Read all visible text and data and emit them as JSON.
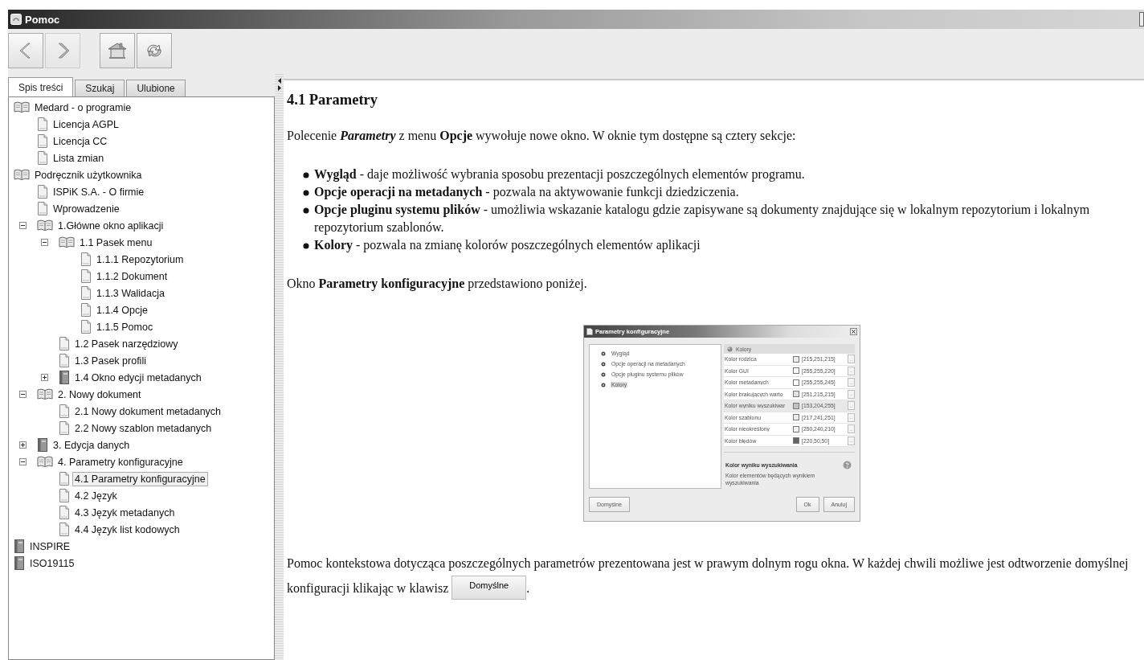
{
  "window": {
    "title": "Pomoc"
  },
  "toolbar": {
    "groups": [
      [
        {
          "kind": "back",
          "disabled": false
        },
        {
          "kind": "forward",
          "disabled": true
        }
      ],
      [
        {
          "kind": "home",
          "disabled": false
        },
        {
          "kind": "refresh",
          "disabled": false
        }
      ]
    ]
  },
  "tabs": [
    {
      "label": "Spis treści",
      "selected": true
    },
    {
      "label": "Szukaj",
      "selected": false
    },
    {
      "label": "Ulubione",
      "selected": false
    }
  ],
  "tree": {
    "items": [
      {
        "label": "Medard - o programie",
        "kind": "book",
        "expanded": true,
        "toggle": false,
        "selected": false,
        "children": [
          {
            "label": "Licencja AGPL",
            "kind": "page",
            "selected": false
          },
          {
            "label": "Licencja CC",
            "kind": "page",
            "selected": false
          },
          {
            "label": "Lista zmian",
            "kind": "page",
            "selected": false
          }
        ]
      },
      {
        "label": "Podręcznik użytkownika",
        "kind": "book",
        "expanded": true,
        "toggle": false,
        "selected": false,
        "children": [
          {
            "label": "ISPiK S.A. - O firmie",
            "kind": "page",
            "selected": false
          },
          {
            "label": "Wprowadzenie",
            "kind": "page",
            "selected": false
          },
          {
            "label": "1.Główne okno aplikacji",
            "kind": "book",
            "expanded": true,
            "toggle": true,
            "selected": false,
            "children": [
              {
                "label": "1.1 Pasek menu",
                "kind": "book",
                "expanded": true,
                "toggle": true,
                "selected": false,
                "children": [
                  {
                    "label": "1.1.1 Repozytorium",
                    "kind": "page",
                    "selected": false
                  },
                  {
                    "label": "1.1.2 Dokument",
                    "kind": "page",
                    "selected": false
                  },
                  {
                    "label": "1.1.3 Walidacja",
                    "kind": "page",
                    "selected": false
                  },
                  {
                    "label": "1.1.4 Opcje",
                    "kind": "page",
                    "selected": false
                  },
                  {
                    "label": "1.1.5 Pomoc",
                    "kind": "page",
                    "selected": false
                  }
                ]
              },
              {
                "label": "1.2 Pasek narzędziowy",
                "kind": "page",
                "selected": false
              },
              {
                "label": "1.3 Pasek profili",
                "kind": "page",
                "selected": false
              },
              {
                "label": "1.4 Okno edycji metadanych",
                "kind": "book",
                "expanded": false,
                "toggle": true,
                "selected": false
              }
            ]
          },
          {
            "label": "2. Nowy dokument",
            "kind": "book",
            "expanded": true,
            "toggle": true,
            "selected": false,
            "children": [
              {
                "label": "2.1 Nowy dokument metadanych",
                "kind": "page",
                "selected": false
              },
              {
                "label": "2.2 Nowy szablon metadanych",
                "kind": "page",
                "selected": false
              }
            ]
          },
          {
            "label": "3. Edycja danych",
            "kind": "book",
            "expanded": false,
            "toggle": true,
            "selected": false
          },
          {
            "label": "4. Parametry konfiguracyjne",
            "kind": "book",
            "expanded": true,
            "toggle": true,
            "selected": false,
            "children": [
              {
                "label": "4.1 Parametry konfiguracyjne",
                "kind": "page",
                "selected": true
              },
              {
                "label": "4.2 Język",
                "kind": "page",
                "selected": false
              },
              {
                "label": "4.3 Język metadanych",
                "kind": "page",
                "selected": false
              },
              {
                "label": "4.4 Język list kodowych",
                "kind": "page",
                "selected": false
              }
            ]
          }
        ]
      },
      {
        "label": "INSPIRE",
        "kind": "book",
        "expanded": false,
        "toggle": false,
        "selected": false
      },
      {
        "label": "ISO19115",
        "kind": "book",
        "expanded": false,
        "toggle": false,
        "selected": false
      }
    ]
  },
  "content": {
    "heading": "4.1 Parametry",
    "intro": "Polecenie *Parametry* z menu **Opcje** wywołuje nowe okno. W oknie tym dostępne są cztery sekcje:",
    "bullets": [
      "**Wygląd** - daje możliwość wybrania sposobu prezentacji poszczególnych elementów programu.",
      "**Opcje operacji na metadanych** - pozwala na aktywowanie funkcji dziedziczenia.",
      "**Opcje pluginu systemu plików** - umożliwia wskazanie katalogu gdzie zapisywane są dokumenty znajdujące się w lokalnym repozytorium i lokalnym repozytorium szablonów.",
      "**Kolory** - pozwala na zmianę kolorów poszczególnych elementów aplikacji"
    ],
    "caption": "Okno **Parametry konfiguracyjne** przedstawiono poniżej.",
    "figure": {
      "title": "Parametry konfiguracyjne",
      "sections": [
        {
          "label": "Wygląd",
          "selected": false
        },
        {
          "label": "Opcje operacji na metadanych",
          "selected": false
        },
        {
          "label": "Opcje pluginu systemu plików",
          "selected": false
        },
        {
          "label": "Kolory",
          "selected": true
        }
      ],
      "panel_title": "Kolory",
      "rows": [
        {
          "name": "Kolor rodzica",
          "value": "[215,251,215]",
          "color": "#ececec",
          "selected": false
        },
        {
          "name": "Kolor GUI",
          "value": "[255,255,220]",
          "color": "#fbfbfb",
          "selected": false
        },
        {
          "name": "Kolor metadanych",
          "value": "[255,255,245]",
          "color": "#fefefe",
          "selected": false
        },
        {
          "name": "Kolor brakujących warto",
          "value": "[251,215,215]",
          "color": "#e2e2e2",
          "selected": false
        },
        {
          "name": "Kolor wyniku wyszukiwar",
          "value": "[153,204,255]",
          "color": "#c2c2c2",
          "selected": true
        },
        {
          "name": "Kolor szablonu",
          "value": "[217,241,251]",
          "color": "#ebebeb",
          "selected": false
        },
        {
          "name": "Kolor nieokreślony",
          "value": "[250,240,210]",
          "color": "#f0f0f0",
          "selected": false
        },
        {
          "name": "Kolor błędów",
          "value": "[220,50,50]",
          "color": "#656565",
          "selected": false
        }
      ],
      "row_button": "...",
      "help_title": "Kolor wyniku wyszukiwania",
      "help_text": "Kolor elementów będących wynikiem wyszukiwania",
      "left_buttons": [
        "Domyślne"
      ],
      "right_buttons": [
        "Ok",
        "Anuluj"
      ]
    },
    "outro": {
      "text": "Pomoc kontekstowa dotycząca poszczególnych parametrów prezentowana jest w prawym dolnym rogu okna. W każdej chwili możliwe jest odtworzenie domyślnej konfiguracji klikając w klawisz",
      "button": "Domyślne",
      "after": "."
    }
  }
}
